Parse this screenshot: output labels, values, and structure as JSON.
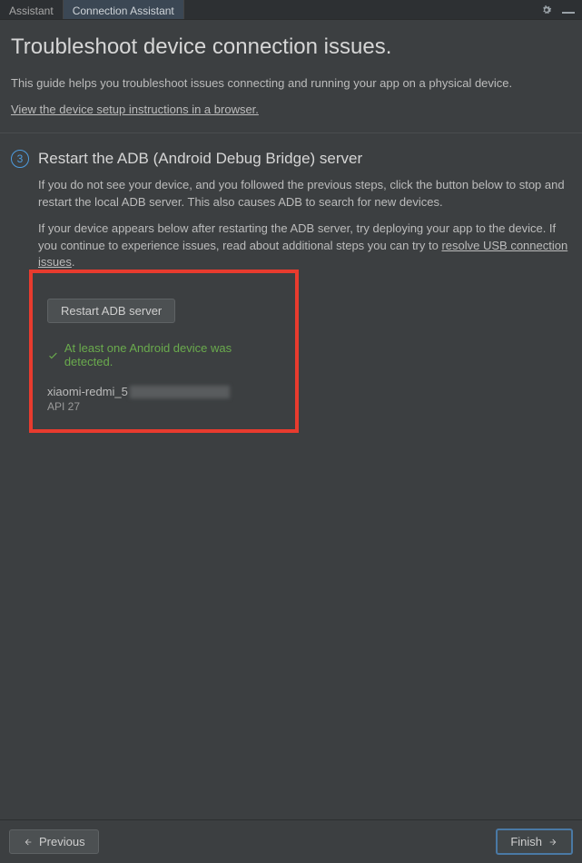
{
  "tabs": {
    "assistant": "Assistant",
    "connection": "Connection Assistant"
  },
  "header": {
    "title": "Troubleshoot device connection issues.",
    "intro": "This guide helps you troubleshoot issues connecting and running your app on a physical device.",
    "setup_link": "View the device setup instructions in a browser."
  },
  "step": {
    "number": "3",
    "title": "Restart the ADB (Android Debug Bridge) server",
    "para1": "If you do not see your device, and you followed the previous steps, click the button below to stop and restart the local ADB server. This also causes ADB to search for new devices.",
    "para2_a": "If your device appears below after restarting the ADB server, try deploying your app to the device. If you continue to experience issues, read about additional steps you can try to ",
    "para2_link": "resolve USB connection issues",
    "para2_b": "."
  },
  "actions": {
    "restart": "Restart ADB server"
  },
  "status": {
    "success": "At least one Android device was detected."
  },
  "device": {
    "name": "xiaomi-redmi_5",
    "api": "API 27"
  },
  "footer": {
    "previous": "Previous",
    "finish": "Finish"
  }
}
